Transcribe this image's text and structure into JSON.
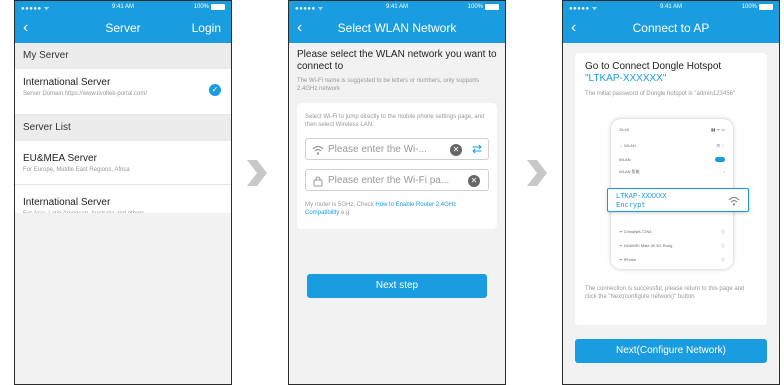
{
  "status_bar": {
    "signal": "●●●●● ᯤ",
    "time": "9:41 AM",
    "battery": "100%"
  },
  "colors": {
    "accent": "#1a9de0",
    "background": "#f2f2f2",
    "arrow": "#c8c8c8"
  },
  "screen1": {
    "title": "Server",
    "login": "Login",
    "my_server_header": "My Server",
    "my_server": {
      "name": "International Server",
      "domain": "Server Domain:https://www.livoltek-portal.com/"
    },
    "server_list_header": "Server List",
    "servers": [
      {
        "name": "EU&MEA Server",
        "desc": "For Europe, Middle East Regions, Africa"
      },
      {
        "name": "International Server",
        "desc": "For Asia, Latin American, Australia and others"
      }
    ]
  },
  "screen2": {
    "title": "Select WLAN Network",
    "heading": "Please select the WLAN network you want to connect to",
    "note": "The Wi-Fi name is suggested to be letters or numbers, only supports 2.4GHz network",
    "tip": "Select Wi-Fi to jump directly to the mobile phone settings page, and then select Wireless LAN.",
    "wifi_placeholder": "Please enter the Wi-...",
    "password_placeholder": "Please enter the Wi-Fi pa...",
    "router_text": "My router is 5GHz, Check ",
    "router_link": "How to Enable Router 2.4GHz Compatibility",
    "router_suffix": " e.g",
    "next": "Next step"
  },
  "screen3": {
    "title": "Connect to AP",
    "heading": "Go to Connect Dongle Hotspot",
    "ssid": "\"LTKAP-XXXXXX\"",
    "password_note": "The initial password of Dongle hotspot is \"admin123456\"",
    "mini_phone": {
      "time": "15:40",
      "status": "▮▮ ᯤ ▭",
      "wlan_title": "← WLAN",
      "wlan_menu": "⊟ ⋮",
      "wlan_label": "WLAN",
      "wlan_plus": "WLAN 智能",
      "networks": [
        "ChinaNet-T2N4",
        "HUAWEI Mate 30 5G Rong",
        "iPhone"
      ]
    },
    "highlight_ssid": "LTKAP-XXXXXX",
    "highlight_encrypt": "Encrypt",
    "success": "The connection is successful, please return to this page and click the \"Next(configure network)\" button",
    "next": "Next(Configure Network)"
  }
}
